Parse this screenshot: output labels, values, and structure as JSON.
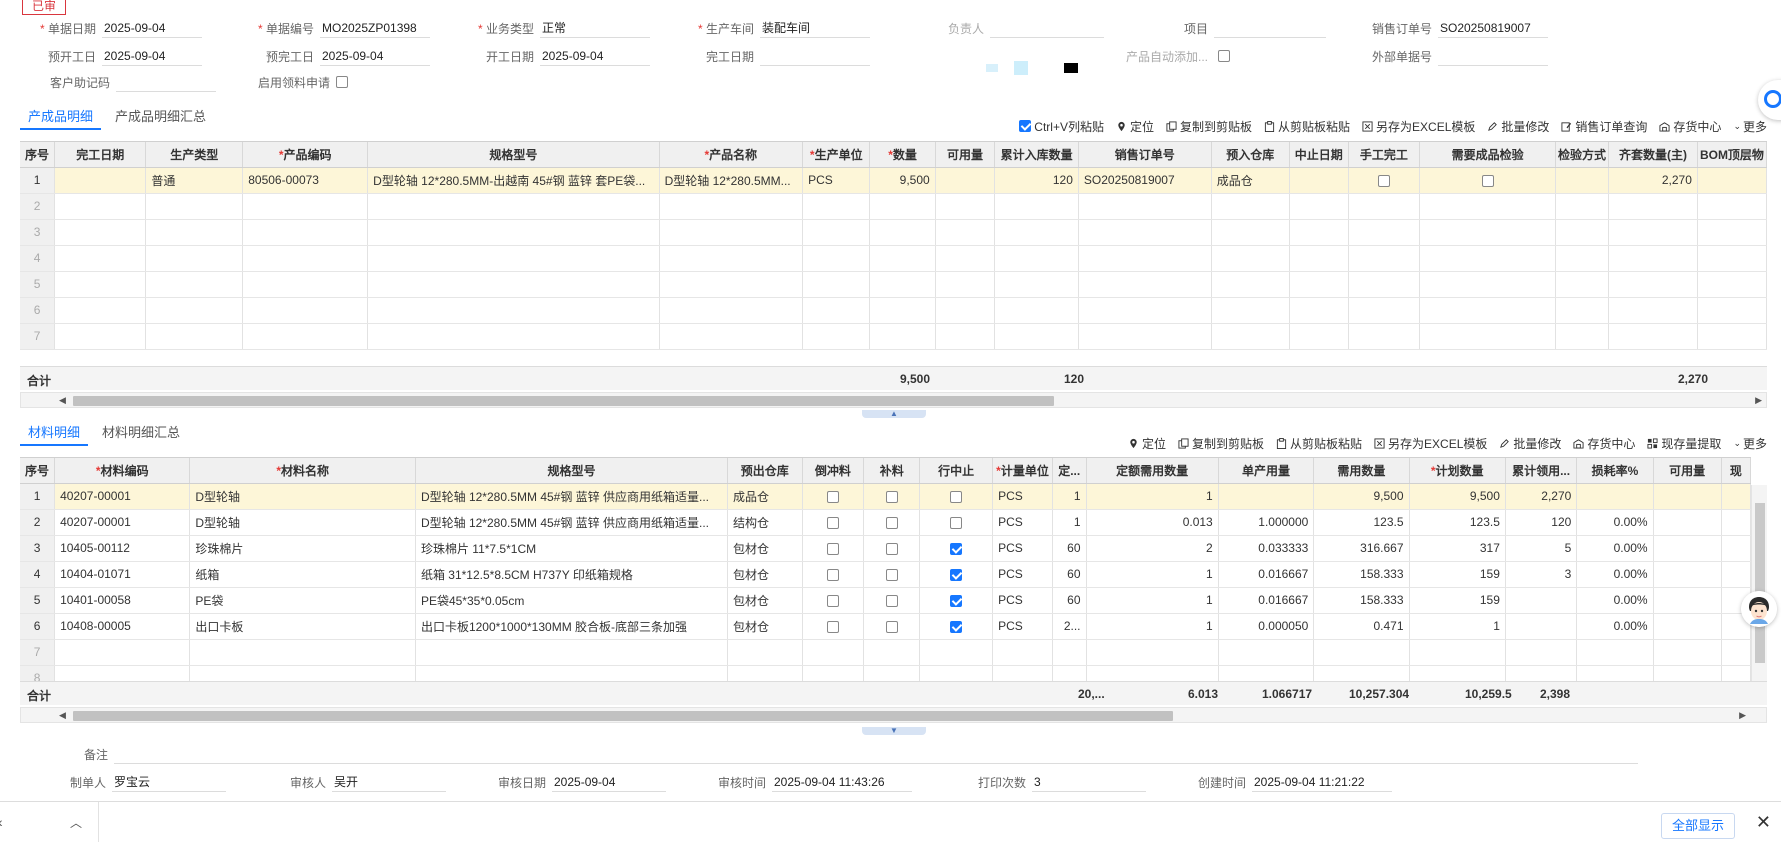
{
  "status_stamp": "已审",
  "header": {
    "row1": [
      {
        "label": "单据日期",
        "required": true,
        "value": "2025-09-04"
      },
      {
        "label": "单据编号",
        "required": true,
        "value": "MO2025ZP01398"
      },
      {
        "label": "业务类型",
        "required": true,
        "value": "正常"
      },
      {
        "label": "生产车间",
        "required": true,
        "value": "装配车间"
      },
      {
        "label": "负责人",
        "required": false,
        "value": ""
      },
      {
        "label": "项目",
        "required": false,
        "value": ""
      },
      {
        "label": "销售订单号",
        "required": false,
        "value": "SO20250819007"
      }
    ],
    "row2": [
      {
        "label": "预开工日",
        "value": "2025-09-04"
      },
      {
        "label": "预完工日",
        "value": "2025-09-04"
      },
      {
        "label": "开工日期",
        "value": "2025-09-04"
      },
      {
        "label": "完工日期",
        "value": ""
      },
      {
        "label": "产品自动添加...",
        "value": ""
      },
      {
        "label": "外部单据号",
        "value": ""
      }
    ],
    "row3": [
      {
        "label": "客户助记码",
        "value": ""
      },
      {
        "label": "启用领料申请",
        "value": ""
      }
    ]
  },
  "product_section": {
    "tabs": [
      "产成品明细",
      "产成品明细汇总"
    ],
    "active_tab": 0,
    "toolbar": [
      "Ctrl+V列粘贴",
      "定位",
      "复制到剪贴板",
      "从剪贴板粘贴",
      "另存为EXCEL模板",
      "批量修改",
      "销售订单查询",
      "存货中心",
      "更多"
    ],
    "columns": [
      {
        "label": "序号",
        "required": false
      },
      {
        "label": "完工日期",
        "required": false
      },
      {
        "label": "生产类型",
        "required": false
      },
      {
        "label": "产品编码",
        "required": true
      },
      {
        "label": "规格型号",
        "required": false
      },
      {
        "label": "产品名称",
        "required": true
      },
      {
        "label": "生产单位",
        "required": true
      },
      {
        "label": "数量",
        "required": true
      },
      {
        "label": "可用量",
        "required": false
      },
      {
        "label": "累计入库数量",
        "required": false
      },
      {
        "label": "销售订单号",
        "required": false
      },
      {
        "label": "预入仓库",
        "required": false
      },
      {
        "label": "中止日期",
        "required": false
      },
      {
        "label": "手工完工",
        "required": false
      },
      {
        "label": "需要成品检验",
        "required": false
      },
      {
        "label": "检验方式",
        "required": false
      },
      {
        "label": "齐套数量(主)",
        "required": false
      },
      {
        "label": "BOM顶层物",
        "required": false
      }
    ],
    "rows": [
      {
        "seq": "1",
        "finish_date": "",
        "prod_type": "普通",
        "code": "80506-00073",
        "spec": "D型轮轴 12*280.5MM-出越南 45#钢 蓝锌 套PE袋...",
        "name": "D型轮轴 12*280.5MM...",
        "unit": "PCS",
        "qty": "9,500",
        "avail": "",
        "cum_in": "120",
        "so": "SO20250819007",
        "wh": "成品仓",
        "stop_date": "",
        "manual_done": false,
        "need_check": false,
        "check_method": "",
        "kit_qty": "2,270",
        "bom_top": ""
      }
    ],
    "blank_rows": [
      "2",
      "3",
      "4",
      "5",
      "6",
      "7"
    ],
    "total": {
      "label": "合计",
      "qty": "9,500",
      "cum_in": "120",
      "kit_qty": "2,270"
    }
  },
  "material_section": {
    "tabs": [
      "材料明细",
      "材料明细汇总"
    ],
    "active_tab": 0,
    "toolbar": [
      "定位",
      "复制到剪贴板",
      "从剪贴板粘贴",
      "另存为EXCEL模板",
      "批量修改",
      "存货中心",
      "现存量提取",
      "更多"
    ],
    "columns": [
      {
        "label": "序号",
        "required": false
      },
      {
        "label": "材料编码",
        "required": true
      },
      {
        "label": "材料名称",
        "required": true
      },
      {
        "label": "规格型号",
        "required": false
      },
      {
        "label": "预出仓库",
        "required": false
      },
      {
        "label": "倒冲料",
        "required": false
      },
      {
        "label": "补料",
        "required": false
      },
      {
        "label": "行中止",
        "required": false
      },
      {
        "label": "计量单位",
        "required": true
      },
      {
        "label": "定...",
        "required": false
      },
      {
        "label": "定额需用数量",
        "required": false
      },
      {
        "label": "单产用量",
        "required": false
      },
      {
        "label": "需用数量",
        "required": false
      },
      {
        "label": "计划数量",
        "required": true
      },
      {
        "label": "累计领用...",
        "required": false
      },
      {
        "label": "损耗率%",
        "required": false
      },
      {
        "label": "可用量",
        "required": false
      },
      {
        "label": "现",
        "required": false
      }
    ],
    "rows": [
      {
        "seq": "1",
        "code": "40207-00001",
        "name": "D型轮轴",
        "spec": "D型轮轴 12*280.5MM 45#钢 蓝锌 供应商用纸箱适量...",
        "wh": "成品仓",
        "backflush": false,
        "supp": false,
        "stop": false,
        "unit": "PCS",
        "fix": "1",
        "quota": "1",
        "per": "",
        "need": "9,500",
        "plan": "9,500",
        "cum": "2,270",
        "loss": ""
      },
      {
        "seq": "2",
        "code": "40207-00001",
        "name": "D型轮轴",
        "spec": "D型轮轴 12*280.5MM 45#钢 蓝锌 供应商用纸箱适量...",
        "wh": "结构仓",
        "backflush": false,
        "supp": false,
        "stop": false,
        "unit": "PCS",
        "fix": "1",
        "quota": "0.013",
        "per": "1.000000",
        "need": "123.5",
        "plan": "123.5",
        "cum": "120",
        "loss": "0.00%"
      },
      {
        "seq": "3",
        "code": "10405-00112",
        "name": "珍珠棉片",
        "spec": "珍珠棉片 11*7.5*1CM",
        "wh": "包材仓",
        "backflush": false,
        "supp": false,
        "stop": true,
        "unit": "PCS",
        "fix": "60",
        "quota": "2",
        "per": "0.033333",
        "need": "316.667",
        "plan": "317",
        "cum": "5",
        "loss": "0.00%"
      },
      {
        "seq": "4",
        "code": "10404-01071",
        "name": "纸箱",
        "spec": "纸箱 31*12.5*8.5CM H737Y 印纸箱规格",
        "wh": "包材仓",
        "backflush": false,
        "supp": false,
        "stop": true,
        "unit": "PCS",
        "fix": "60",
        "quota": "1",
        "per": "0.016667",
        "need": "158.333",
        "plan": "159",
        "cum": "3",
        "loss": "0.00%"
      },
      {
        "seq": "5",
        "code": "10401-00058",
        "name": "PE袋",
        "spec": "PE袋45*35*0.05cm",
        "wh": "包材仓",
        "backflush": false,
        "supp": false,
        "stop": true,
        "unit": "PCS",
        "fix": "60",
        "quota": "1",
        "per": "0.016667",
        "need": "158.333",
        "plan": "159",
        "cum": "",
        "loss": "0.00%"
      },
      {
        "seq": "6",
        "code": "10408-00005",
        "name": "出口卡板",
        "spec": "出口卡板1200*1000*130MM 胶合板-底部三条加强",
        "wh": "包材仓",
        "backflush": false,
        "supp": false,
        "stop": true,
        "unit": "PCS",
        "fix": "2...",
        "quota": "1",
        "per": "0.000050",
        "need": "0.471",
        "plan": "1",
        "cum": "",
        "loss": "0.00%"
      }
    ],
    "blank_rows": [
      "7",
      "8"
    ],
    "total": {
      "label": "合计",
      "fix": "20,...",
      "quota": "6.013",
      "per": "1.066717",
      "need": "10,257.304",
      "plan": "10,259.5",
      "cum": "2,398"
    }
  },
  "footer": {
    "remark_label": "备注",
    "remark_value": "",
    "fields": [
      {
        "label": "制单人",
        "value": "罗宝云"
      },
      {
        "label": "审核人",
        "value": "吴开"
      },
      {
        "label": "审核日期",
        "value": "2025-09-04"
      },
      {
        "label": "审核时间",
        "value": "2025-09-04 11:43:26"
      },
      {
        "label": "打印次数",
        "value": "3"
      },
      {
        "label": "创建时间",
        "value": "2025-09-04 11:21:22"
      }
    ]
  },
  "bottom_bar": {
    "show_all": "全部显示"
  },
  "colors": {
    "accent": "#1677ff",
    "required": "#e53935",
    "row_highlight": "#fdf6d8",
    "stamp": "#d9363e"
  }
}
